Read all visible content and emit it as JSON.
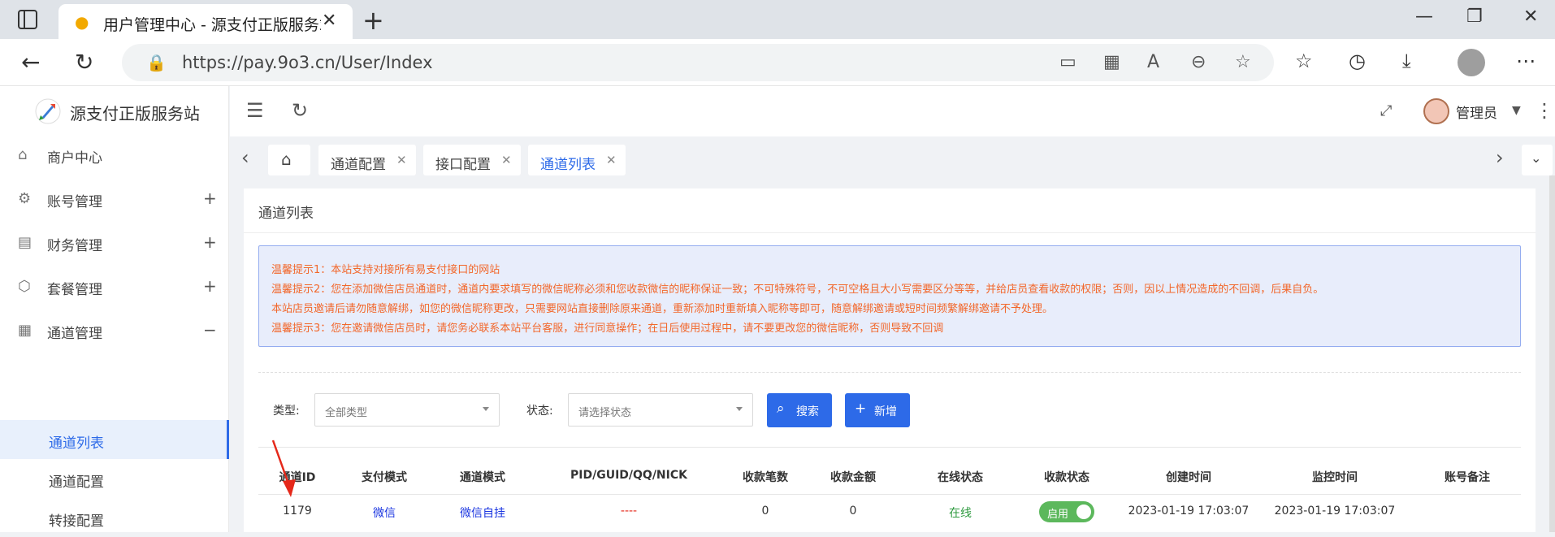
{
  "browser": {
    "tab_title": "用户管理中心 - 源支付正版服务站",
    "url": "https://pay.9o3.cn/User/Index"
  },
  "site": {
    "logo_text": "源支付正版服务站"
  },
  "sidebar": {
    "menu": [
      {
        "label": "商户中心",
        "icon": "home-icon",
        "expander": ""
      },
      {
        "label": "账号管理",
        "icon": "gear-icon",
        "expander": "+"
      },
      {
        "label": "财务管理",
        "icon": "ledger-icon",
        "expander": "+"
      },
      {
        "label": "套餐管理",
        "icon": "box-icon",
        "expander": "+"
      },
      {
        "label": "通道管理",
        "icon": "grid-icon",
        "expander": "−"
      }
    ],
    "submenu": [
      {
        "label": "通道列表",
        "active": true
      },
      {
        "label": "通道配置",
        "active": false
      },
      {
        "label": "转接配置",
        "active": false
      }
    ]
  },
  "header": {
    "user_label": "管理员"
  },
  "tabs": [
    {
      "label": "通道配置",
      "active": false
    },
    {
      "label": "接口配置",
      "active": false
    },
    {
      "label": "通道列表",
      "active": true
    }
  ],
  "card": {
    "title": "通道列表",
    "notices": [
      "温馨提示1：本站支持对接所有易支付接口的网站",
      "温馨提示2：您在添加微信店员通道时，通道内要求填写的微信昵称必须和您收款微信的昵称保证一致；不可特殊符号，不可空格且大小写需要区分等等，并给店员查看收款的权限；否则，因以上情况造成的不回调，后果自负。",
      "本站店员邀请后请勿随意解绑，如您的微信昵称更改，只需要网站直接删除原来通道，重新添加时重新填入昵称等即可，随意解绑邀请或短时间频繁解绑邀请不予处理。",
      "温馨提示3：您在邀请微信店员时，请您务必联系本站平台客服，进行同意操作；在日后使用过程中，请不要更改您的微信昵称，否则导致不回调"
    ]
  },
  "filters": {
    "type_label": "类型:",
    "type_value": "全部类型",
    "status_label": "状态:",
    "status_value": "请选择状态",
    "search_label": "搜索",
    "add_label": "新增"
  },
  "table": {
    "headers": [
      "通道ID",
      "支付模式",
      "通道模式",
      "PID/GUID/QQ/NICK",
      "收款笔数",
      "收款金额",
      "在线状态",
      "收款状态",
      "创建时间",
      "监控时间",
      "账号备注"
    ],
    "rows": [
      {
        "id": "1179",
        "pay_mode": "微信",
        "channel_mode": "微信自挂",
        "pid": "----",
        "count": "0",
        "amount": "0",
        "online": "在线",
        "collect": "启用",
        "created": "2023-01-19 17:03:07",
        "monitored": "2023-01-19 17:03:07",
        "remark": ""
      }
    ]
  },
  "colors": {
    "accent": "#2d6ae8",
    "notice_text": "#f2672b",
    "online": "#2e9a3f",
    "toggle": "#5cb85c"
  }
}
